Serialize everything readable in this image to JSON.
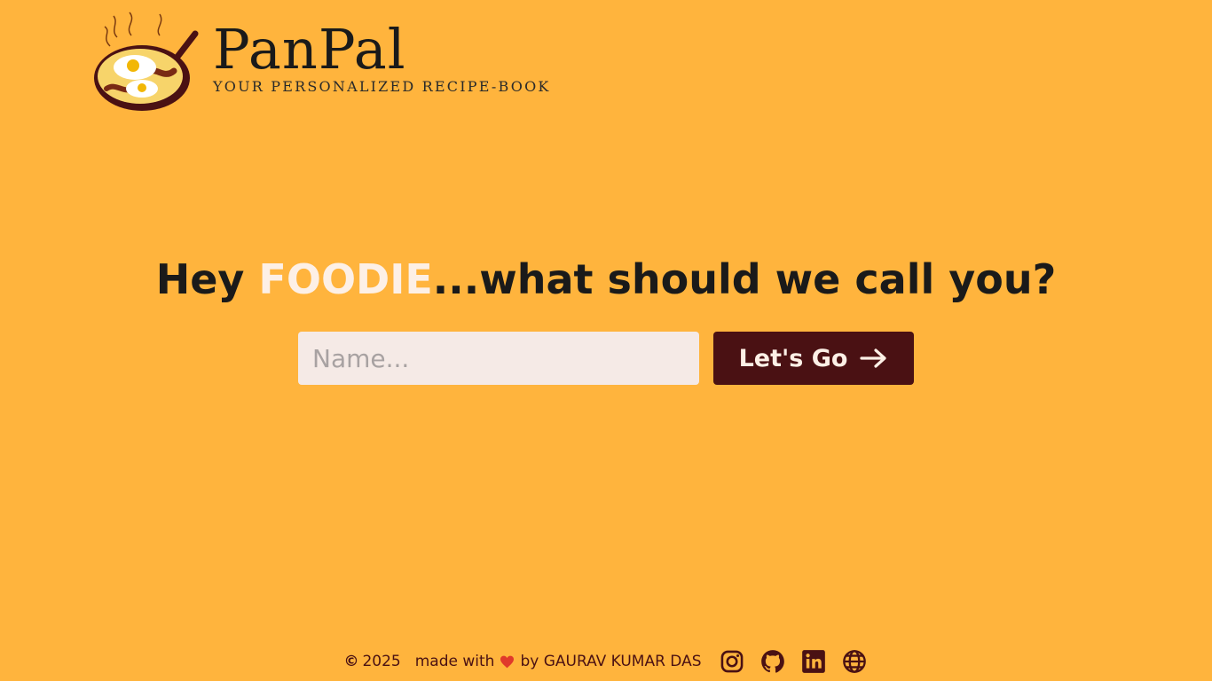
{
  "brand": {
    "title": "PanPal",
    "tagline": "YOUR PERSONALIZED RECIPE-BOOK",
    "logo_icon": "frying-pan-eggs-icon"
  },
  "hero": {
    "prefix": "Hey ",
    "accent": "FOODIE",
    "suffix": "...what should we call you?"
  },
  "form": {
    "name_placeholder": "Name...",
    "name_value": "",
    "submit_label": "Let's Go",
    "submit_icon": "arrow-right-icon"
  },
  "footer": {
    "copyright_symbol": "©",
    "year": "2025",
    "made_with": "made with",
    "by": "by GAURAV KUMAR DAS",
    "heart_icon": "heart-icon",
    "social": [
      {
        "name": "instagram-icon"
      },
      {
        "name": "github-icon"
      },
      {
        "name": "linkedin-icon"
      },
      {
        "name": "globe-icon"
      }
    ]
  },
  "colors": {
    "background": "#FFB43D",
    "accent_text": "#FDF0E6",
    "button": "#4A1113",
    "input_bg": "#F5EAE6"
  }
}
